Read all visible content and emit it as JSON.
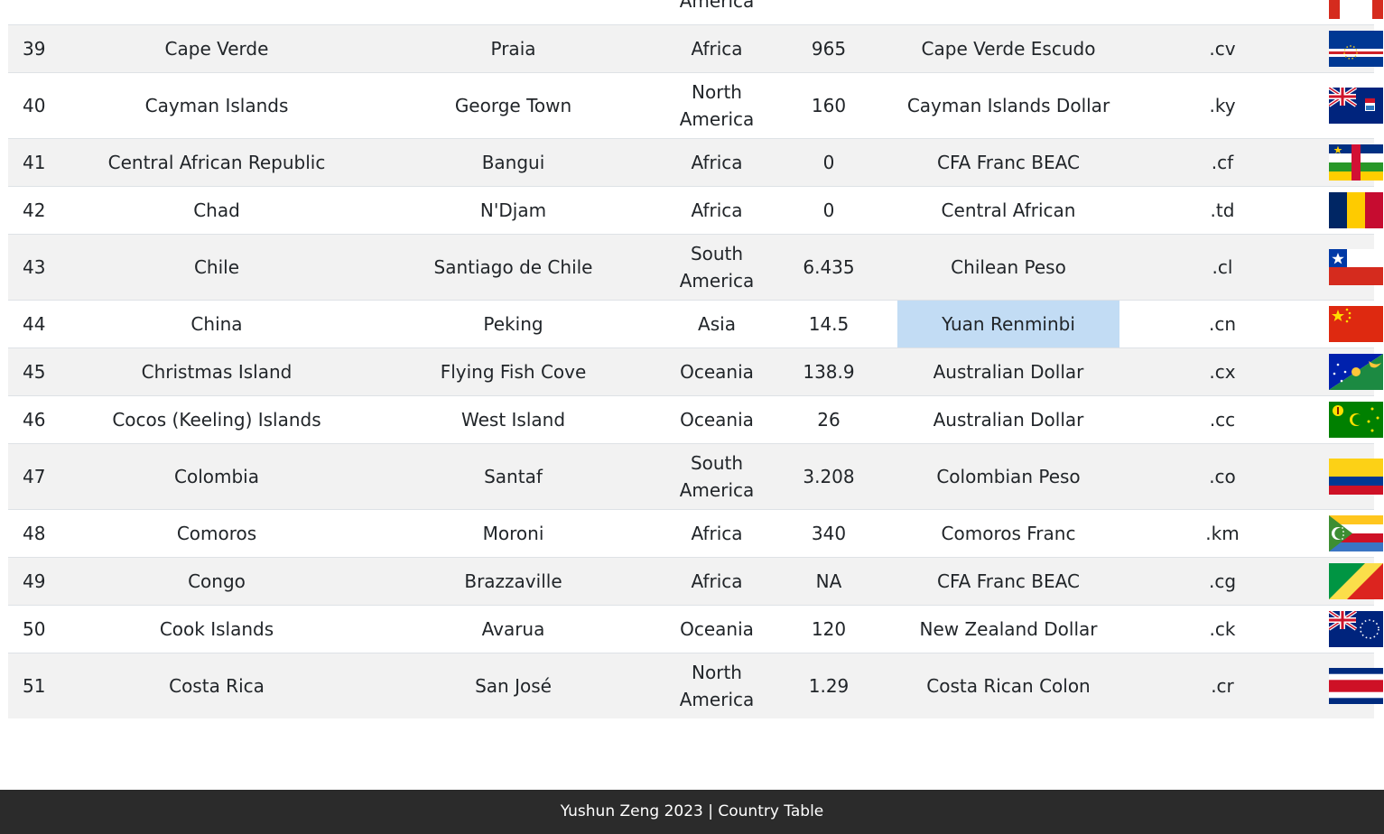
{
  "rows": [
    {
      "idx": "",
      "country": "",
      "capital": "",
      "continent": "America",
      "area": "",
      "currency": "",
      "tld": "",
      "flag": "partial-flag"
    },
    {
      "idx": "39",
      "country": "Cape Verde",
      "capital": "Praia",
      "continent": "Africa",
      "area": "965",
      "currency": "Cape Verde Escudo",
      "tld": ".cv",
      "flag": "cape-verde-flag"
    },
    {
      "idx": "40",
      "country": "Cayman Islands",
      "capital": "George Town",
      "continent": "North America",
      "area": "160",
      "currency": "Cayman Islands Dollar",
      "tld": ".ky",
      "flag": "cayman-islands-flag"
    },
    {
      "idx": "41",
      "country": "Central African Republic",
      "capital": "Bangui",
      "continent": "Africa",
      "area": "0",
      "currency": "CFA Franc BEAC",
      "tld": ".cf",
      "flag": "central-african-republic-flag"
    },
    {
      "idx": "42",
      "country": "Chad",
      "capital": "N'Djam",
      "continent": "Africa",
      "area": "0",
      "currency": "Central African",
      "tld": ".td",
      "flag": "chad-flag"
    },
    {
      "idx": "43",
      "country": "Chile",
      "capital": "Santiago de Chile",
      "continent": "South America",
      "area": "6.435",
      "currency": "Chilean Peso",
      "tld": ".cl",
      "flag": "chile-flag"
    },
    {
      "idx": "44",
      "country": "China",
      "capital": "Peking",
      "continent": "Asia",
      "area": "14.5",
      "currency": "Yuan Renminbi",
      "tld": ".cn",
      "flag": "china-flag"
    },
    {
      "idx": "45",
      "country": "Christmas Island",
      "capital": "Flying Fish Cove",
      "continent": "Oceania",
      "area": "138.9",
      "currency": "Australian Dollar",
      "tld": ".cx",
      "flag": "christmas-island-flag"
    },
    {
      "idx": "46",
      "country": "Cocos (Keeling) Islands",
      "capital": "West Island",
      "continent": "Oceania",
      "area": "26",
      "currency": "Australian Dollar",
      "tld": ".cc",
      "flag": "cocos-islands-flag"
    },
    {
      "idx": "47",
      "country": "Colombia",
      "capital": "Santaf",
      "continent": "South America",
      "area": "3.208",
      "currency": "Colombian Peso",
      "tld": ".co",
      "flag": "colombia-flag"
    },
    {
      "idx": "48",
      "country": "Comoros",
      "capital": "Moroni",
      "continent": "Africa",
      "area": "340",
      "currency": "Comoros Franc",
      "tld": ".km",
      "flag": "comoros-flag"
    },
    {
      "idx": "49",
      "country": "Congo",
      "capital": "Brazzaville",
      "continent": "Africa",
      "area": "NA",
      "currency": "CFA Franc BEAC",
      "tld": ".cg",
      "flag": "congo-flag"
    },
    {
      "idx": "50",
      "country": "Cook Islands",
      "capital": "Avarua",
      "continent": "Oceania",
      "area": "120",
      "currency": "New Zealand Dollar",
      "tld": ".ck",
      "flag": "cook-islands-flag"
    },
    {
      "idx": "51",
      "country": "Costa Rica",
      "capital": "San José",
      "continent": "North America",
      "area": "1.29",
      "currency": "Costa Rican Colon",
      "tld": ".cr",
      "flag": "costa-rica-flag"
    }
  ],
  "highlight": {
    "row_index": 6,
    "column": "currency",
    "color": "#c2dcf4"
  },
  "colors": {
    "stripe": "#f2f2f2",
    "footer_bg": "#2b2b2b",
    "footer_text": "#ffffff"
  },
  "footer": {
    "text": "Yushun Zeng 2023 | Country Table"
  }
}
